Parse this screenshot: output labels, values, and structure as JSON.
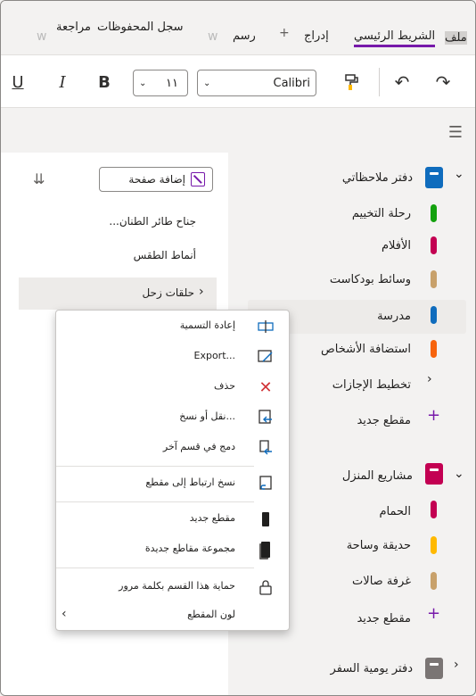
{
  "menu_tabs": {
    "file": "ملف",
    "home": "الشريط الرئيسي",
    "insert": "إدراج",
    "draw": "رسم",
    "history": "سجل المحفوظات",
    "review": "مراجعة"
  },
  "ribbon": {
    "font_name": "Calibri",
    "font_size": "١١"
  },
  "pages_pane": {
    "add_page_label": "إضافة صفحة",
    "items": [
      "جناح طائر الطنان...",
      "أنماط الطقس",
      "حلقات زحل"
    ]
  },
  "notebooks": [
    {
      "name": "دفتر ملاحظاتي",
      "color": "#0f6cbd",
      "sections": [
        {
          "name": "رحلة التخييم",
          "color": "#13a10e"
        },
        {
          "name": "الأفلام",
          "color": "#c30052"
        },
        {
          "name": "وسائط بودكاست",
          "color": "#c8a16b"
        },
        {
          "name": "مدرسة",
          "color": "#0f6cbd"
        },
        {
          "name": "استضافة الأشخاص",
          "color": "#f7630c"
        },
        {
          "name": "تخطيط الإجازات",
          "color": ""
        }
      ],
      "new_section": "مقطع جديد"
    },
    {
      "name": "مشاريع المنزل",
      "color": "#c30052",
      "sections": [
        {
          "name": "الحمام",
          "color": "#c30052"
        },
        {
          "name": "حديقة وساحة",
          "color": "#ffb900"
        },
        {
          "name": "غرفة صالات",
          "color": "#c8a16b"
        }
      ],
      "new_section": "مقطع جديد"
    },
    {
      "name": "دفتر يومية السفر",
      "color": "#7a7574"
    }
  ],
  "context_menu": {
    "items": [
      {
        "label": "إعادة التسمية",
        "icon": "rename-icon"
      },
      {
        "label": "Export...",
        "icon": "export-icon"
      },
      {
        "label": "حذف",
        "icon": "delete-icon"
      },
      {
        "label": "نقل أو نسخ...",
        "icon": "move-copy-icon"
      },
      {
        "label": "دمج في قسم آخر",
        "icon": "merge-icon"
      },
      {
        "label": "نسخ ارتباط إلى مقطع",
        "icon": "copy-link-icon"
      },
      {
        "label": "مقطع جديد",
        "icon": "new-section-icon"
      },
      {
        "label": "مجموعة مقاطع جديدة",
        "icon": "new-section-group-icon"
      },
      {
        "label": "حماية هذا القسم بكلمة مرور",
        "icon": "lock-icon"
      },
      {
        "label": "لون المقطع",
        "icon": "chevron-left-icon"
      }
    ]
  },
  "colors": {
    "accent": "#7719aa",
    "add_icon": "#7719aa",
    "delete_icon": "#d13438",
    "link_icon": "#0f6cbd"
  }
}
